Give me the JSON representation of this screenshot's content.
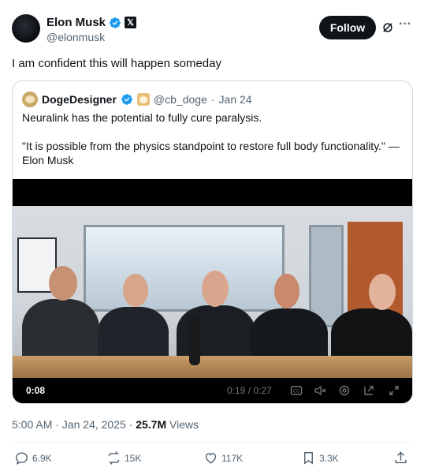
{
  "author": {
    "name": "Elon Musk",
    "handle": "@elonmusk",
    "follow_label": "Follow",
    "more_label": "···"
  },
  "tweet": {
    "text": "I am confident this will happen someday"
  },
  "quote": {
    "name": "DogeDesigner",
    "handle": "@cb_doge",
    "separator": "·",
    "date": "Jan 24",
    "text_line1": "Neuralink has the potential to fully cure paralysis.",
    "text_line2": "\"It is possible from the physics standpoint to restore full body functionality.\" — Elon Musk"
  },
  "video": {
    "elapsed": "0:08",
    "progress": "0:19 / 0:27",
    "controls": [
      "captions-icon",
      "mute-icon",
      "settings-icon",
      "pip-icon",
      "fullscreen-icon"
    ]
  },
  "meta": {
    "timestamp": "5:00 AM · Jan 24, 2025 · ",
    "views_count": "25.7M",
    "views_label": " Views"
  },
  "actions": {
    "replies": "6.9K",
    "reposts": "15K",
    "likes": "117K",
    "bookmarks": "3.3K"
  },
  "colors": {
    "verified_blue": "#1d9bf0",
    "text_primary": "#0f1419",
    "text_secondary": "#536471",
    "border": "#cfd9de"
  }
}
